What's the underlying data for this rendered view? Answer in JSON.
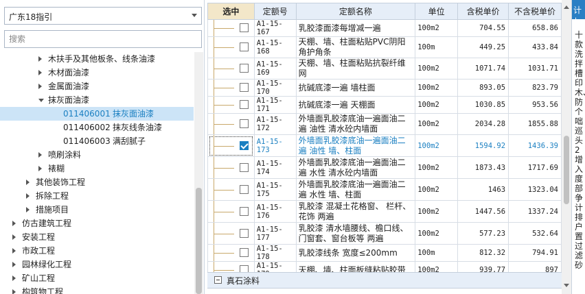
{
  "left": {
    "combo_value": "广东18指引",
    "search_placeholder": "搜索",
    "tree": [
      {
        "label": "木扶手及其他板条、线条油漆",
        "level": 3,
        "arrow": "collapsed"
      },
      {
        "label": "木材面油漆",
        "level": 3,
        "arrow": "collapsed"
      },
      {
        "label": "金属面油漆",
        "level": 3,
        "arrow": "collapsed"
      },
      {
        "label": "抹灰面油漆",
        "level": 3,
        "arrow": "expanded"
      },
      {
        "code": "011406001",
        "label": "抹灰面油漆",
        "level": 4,
        "arrow": "none",
        "selected": true
      },
      {
        "code": "011406002",
        "label": "抹灰线条油漆",
        "level": 4,
        "arrow": "none"
      },
      {
        "code": "011406003",
        "label": "满刮腻子",
        "level": 4,
        "arrow": "none"
      },
      {
        "label": "喷刷涂料",
        "level": 3,
        "arrow": "collapsed"
      },
      {
        "label": "裱糊",
        "level": 3,
        "arrow": "collapsed"
      },
      {
        "label": "其他装饰工程",
        "level": 2,
        "arrow": "collapsed"
      },
      {
        "label": "拆除工程",
        "level": 2,
        "arrow": "collapsed"
      },
      {
        "label": "措施项目",
        "level": 2,
        "arrow": "collapsed"
      },
      {
        "label": "仿古建筑工程",
        "level": 1,
        "arrow": "collapsed"
      },
      {
        "label": "安装工程",
        "level": 1,
        "arrow": "collapsed"
      },
      {
        "label": "市政工程",
        "level": 1,
        "arrow": "collapsed"
      },
      {
        "label": "园林绿化工程",
        "level": 1,
        "arrow": "collapsed"
      },
      {
        "label": "矿山工程",
        "level": 1,
        "arrow": "collapsed"
      },
      {
        "label": "构筑物工程",
        "level": 1,
        "arrow": "collapsed"
      }
    ]
  },
  "grid": {
    "columns": [
      "选中",
      "定额号",
      "定额名称",
      "单位",
      "含税单价",
      "不含税单价"
    ],
    "rows": [
      {
        "checked": false,
        "code": "A1-15-167",
        "name": "乳胶漆面漆每增减一遍",
        "unit": "100m2",
        "price_tax": "704.55",
        "price_notax": "658.86"
      },
      {
        "checked": false,
        "code": "A1-15-168",
        "name": "天棚、墙、柱面粘贴PVC阴阳角护角条",
        "unit": "100m",
        "price_tax": "449.25",
        "price_notax": "433.84"
      },
      {
        "checked": false,
        "code": "A1-15-169",
        "name": "天棚、墙、柱面粘贴抗裂纤维网",
        "unit": "100m2",
        "price_tax": "1071.74",
        "price_notax": "1031.71"
      },
      {
        "checked": false,
        "code": "A1-15-170",
        "name": "抗碱底漆一遍 墙柱面",
        "unit": "100m2",
        "price_tax": "893.05",
        "price_notax": "823.79"
      },
      {
        "checked": false,
        "code": "A1-15-171",
        "name": "抗碱底漆一遍 天棚面",
        "unit": "100m2",
        "price_tax": "1030.85",
        "price_notax": "953.56"
      },
      {
        "checked": false,
        "code": "A1-15-172",
        "name": "外墙面乳胶漆底油一遍面油二遍 油性 清水砼内墙面",
        "unit": "100m2",
        "price_tax": "2034.28",
        "price_notax": "1855.88"
      },
      {
        "checked": true,
        "code": "A1-15-173",
        "name": "外墙面乳胶漆底油一遍面油二遍 油性 墙、柱面",
        "unit": "100m2",
        "price_tax": "1594.92",
        "price_notax": "1436.39"
      },
      {
        "checked": false,
        "code": "A1-15-174",
        "name": "外墙面乳胶漆底油一遍面油二遍 水性 清水砼内墙面",
        "unit": "100m2",
        "price_tax": "1873.43",
        "price_notax": "1717.69"
      },
      {
        "checked": false,
        "code": "A1-15-175",
        "name": "外墙面乳胶漆底油一遍面油二遍 水性 墙、柱面",
        "unit": "100m2",
        "price_tax": "1463",
        "price_notax": "1323.04"
      },
      {
        "checked": false,
        "code": "A1-15-176",
        "name": "乳胶漆 混凝土花格窗、 栏杆、花饰 两遍",
        "unit": "100m2",
        "price_tax": "1447.56",
        "price_notax": "1337.24"
      },
      {
        "checked": false,
        "code": "A1-15-177",
        "name": "乳胶漆 清水墙腰线、檐口线、门窗套、窗台板等 两遍",
        "unit": "100m2",
        "price_tax": "577.23",
        "price_notax": "532.64"
      },
      {
        "checked": false,
        "code": "A1-15-178",
        "name": "乳胶漆线条 宽度≤200mm",
        "unit": "100m",
        "price_tax": "812.32",
        "price_notax": "794.91"
      },
      {
        "checked": false,
        "code": "A1-15-179",
        "name": "天棚、墙、柱面板缝粘贴胶带",
        "unit": "100m2",
        "price_tax": "939.77",
        "price_notax": "897"
      }
    ],
    "group_label": "真石涂料"
  },
  "strip": {
    "head": "计扌",
    "chars": "十款洗拌槽印木、防个咄巡头2增入度部争计排户置过滤砂"
  }
}
